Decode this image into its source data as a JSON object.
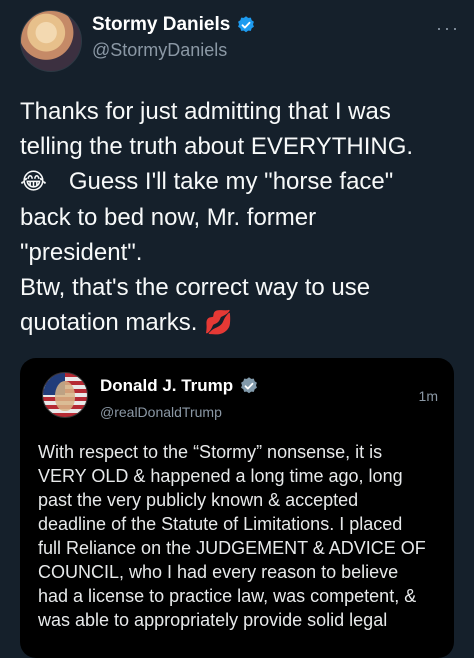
{
  "tweet": {
    "author_name": "Stormy Daniels",
    "author_handle": "@StormyDaniels",
    "more_label": "···",
    "text_line1": "Thanks for just admitting that I was\ntelling the truth about EVERYTHING.",
    "emoji_laugh": "😂",
    "text_line2": "Guess I'll take my \"horse face\"\nback to bed now, Mr. former\n\"president\".\nBtw, that's the correct way to use\nquotation marks.",
    "emoji_kiss": "💋"
  },
  "quoted_tweet": {
    "author_name": "Donald J. Trump",
    "author_handle": "@realDonaldTrump",
    "time": "1m",
    "text": "With respect to the “Stormy” nonsense, it is\nVERY OLD & happened a long time ago, long\npast the very publicly known & accepted\ndeadline of the Statute of Limitations. I placed\nfull Reliance on the JUDGEMENT & ADVICE OF\nCOUNCIL, who I had every reason to believe\nhad a license to practice law, was competent, &\nwas able to appropriately provide solid legal"
  },
  "colors": {
    "background": "#15202b",
    "quote_background": "#000000",
    "verified_blue": "#1d9bf0",
    "verified_gray": "#829aab",
    "muted_text": "#8b98a5"
  },
  "icons": {
    "author_verified": "verified-badge-icon",
    "quote_verified": "gray-verified-badge-icon"
  }
}
